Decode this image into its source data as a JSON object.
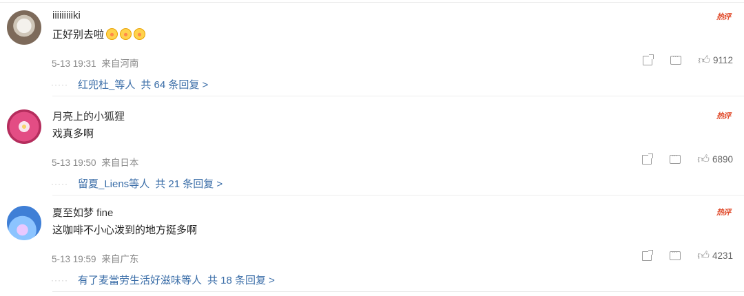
{
  "comments": [
    {
      "username": "iiiiiiiiiki",
      "text": "正好别去啦",
      "emoji_count": 3,
      "emoji_name": "crying-face-icon",
      "date_time": "5-13 19:31",
      "location": "来自河南",
      "badge": "热评",
      "likes": "9112",
      "reply_users": "红兜杜_等人",
      "reply_count": "共 64 条回复 >"
    },
    {
      "username": "月亮上的小狐狸",
      "text": "戏真多啊",
      "emoji_count": 0,
      "date_time": "5-13 19:50",
      "location": "来自日本",
      "badge": "热评",
      "likes": "6890",
      "reply_users": "留夏_Liens等人",
      "reply_count": "共 21 条回复 >"
    },
    {
      "username": "夏至如梦 fine",
      "text": "这咖啡不小心泼到的地方挺多啊",
      "emoji_count": 0,
      "date_time": "5-13 19:59",
      "location": "来自广东",
      "badge": "热评",
      "likes": "4231",
      "reply_users": "有了麦當劳生活好滋味等人",
      "reply_count": "共 18 条回复 >"
    }
  ],
  "colors": {
    "link_blue": "#3b6ea8",
    "badge_red": "#e04b2c",
    "meta_gray": "#888888"
  }
}
